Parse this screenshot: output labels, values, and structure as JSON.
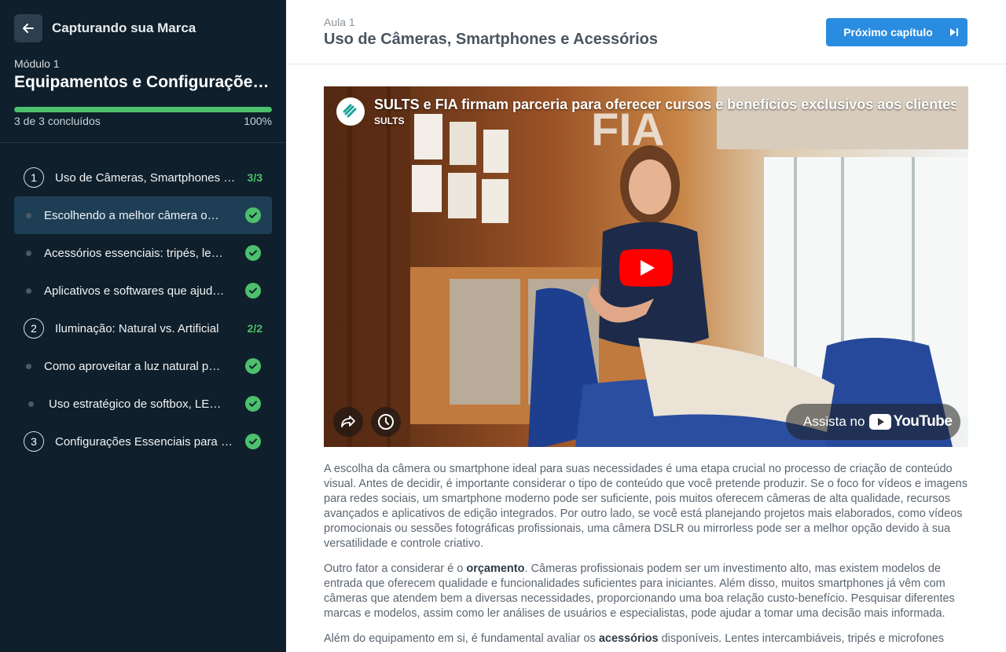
{
  "sidebar": {
    "course_title": "Capturando sua Marca",
    "module_label": "Módulo 1",
    "module_title": "Equipamentos e Configurações Essenciais",
    "progress_text": "3 de 3 concluídos",
    "progress_percent": "100%",
    "progress_value": 1.0,
    "items": [
      {
        "type": "section",
        "number": "1",
        "label": "Uso de Câmeras, Smartphones e Acessórios",
        "count": "3/3"
      },
      {
        "type": "lesson",
        "label": "Escolhendo a melhor câmera ou smartphone",
        "completed": true,
        "active": true
      },
      {
        "type": "lesson",
        "label": "Acessórios essenciais: tripés, lentes e microfones",
        "completed": true
      },
      {
        "type": "lesson",
        "label": "Aplicativos e softwares que ajudam na captura",
        "completed": true
      },
      {
        "type": "section",
        "number": "2",
        "label": "Iluminação: Natural vs. Artificial",
        "count": "2/2"
      },
      {
        "type": "lesson",
        "label": "Como aproveitar a luz natural para fotos",
        "completed": true
      },
      {
        "type": "lesson",
        "label": "Uso estratégico de softbox, LED e refletores",
        "completed": true
      },
      {
        "type": "section",
        "number": "3",
        "label": "Configurações Essenciais para Câmeras",
        "completed": true
      }
    ]
  },
  "header": {
    "lesson_label": "Aula 1",
    "lesson_title": "Uso de Câmeras, Smartphones e Acessórios",
    "next_button": "Próximo capítulo"
  },
  "video": {
    "title": "SULTS e FIA firmam parceria para oferecer cursos e benefícios exclusivos aos clientes",
    "channel": "SULTS",
    "watch_on": "Assista no",
    "youtube_word": "YouTube"
  },
  "content": {
    "p1": "A escolha da câmera ou smartphone ideal para suas necessidades é uma etapa crucial no processo de criação de conteúdo visual. Antes de decidir, é importante considerar o tipo de conteúdo que você pretende produzir. Se o foco for vídeos e imagens para redes sociais, um smartphone moderno pode ser suficiente, pois muitos oferecem câmeras de alta qualidade, recursos avançados e aplicativos de edição integrados. Por outro lado, se você está planejando projetos mais elaborados, como vídeos promocionais ou sessões fotográficas profissionais, uma câmera DSLR ou mirrorless pode ser a melhor opção devido à sua versatilidade e controle criativo.",
    "p2_a": "Outro fator a considerar é o ",
    "p2_b": "orçamento",
    "p2_c": ". Câmeras profissionais podem ser um investimento alto, mas existem modelos de entrada que oferecem qualidade e funcionalidades suficientes para iniciantes. Além disso, muitos smartphones já vêm com câmeras que atendem bem a diversas necessidades, proporcionando uma boa relação custo-benefício. Pesquisar diferentes marcas e modelos, assim como ler análises de usuários e especialistas, pode ajudar a tomar uma decisão mais informada.",
    "p3_a": "Além do equipamento em si, é fundamental avaliar os ",
    "p3_b": "acessórios",
    "p3_c": " disponíveis. Lentes intercambiáveis, tripés e microfones"
  },
  "colors": {
    "sidebar_bg": "#0f1f2b",
    "accent_green": "#4cc06c",
    "button_blue": "#2a8ce0",
    "active_item": "#1e3e55"
  }
}
